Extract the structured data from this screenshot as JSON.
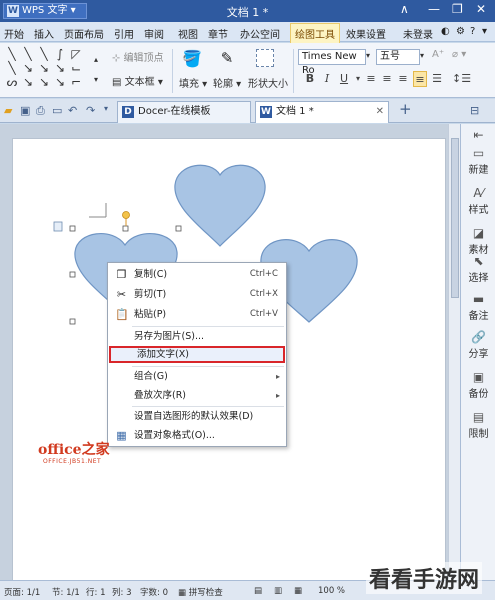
{
  "colors": {
    "accent": "#2f5aa0",
    "shape_fill": "#a8c4e4",
    "shape_stroke": "#6f95c4",
    "highlight": "#d9262a"
  },
  "titlebar": {
    "app_name": "WPS 文字",
    "doc_title": "文档 1 *"
  },
  "menu": {
    "items": [
      "开始",
      "插入",
      "页面布局",
      "引用",
      "审阅",
      "视图",
      "章节",
      "办公空间",
      "绘图工具",
      "效果设置"
    ],
    "active": "绘图工具",
    "login": "未登录"
  },
  "ribbon": {
    "edit_points": "编辑顶点",
    "text_box": "文本框",
    "fill": "填充",
    "outline": "轮廓",
    "shape_size": "形状大小",
    "font_name": "Times New Ro",
    "font_size": "五号",
    "bold": "B",
    "italic": "I",
    "underline": "U"
  },
  "tabs": [
    {
      "label": "Docer-在线模板",
      "badge": "D"
    },
    {
      "label": "文档 1 *",
      "badge": "W"
    }
  ],
  "side_panel": {
    "items": [
      "新建",
      "样式",
      "素材",
      "选择",
      "备注",
      "分享",
      "备份",
      "限制"
    ]
  },
  "context_menu": {
    "items": [
      {
        "label": "复制(C)",
        "shortcut": "Ctrl+C",
        "icon": "copy-icon"
      },
      {
        "label": "剪切(T)",
        "shortcut": "Ctrl+X",
        "icon": "cut-icon"
      },
      {
        "label": "粘贴(P)",
        "shortcut": "Ctrl+V",
        "icon": "paste-icon"
      },
      {
        "label": "另存为图片(S)...",
        "shortcut": ""
      },
      {
        "label": "添加文字(X)",
        "shortcut": "",
        "highlighted": true
      },
      {
        "label": "组合(G)",
        "submenu": true
      },
      {
        "label": "叠放次序(R)",
        "submenu": true
      },
      {
        "label": "设置自选图形的默认效果(D)",
        "shortcut": ""
      },
      {
        "label": "设置对象格式(O)...",
        "shortcut": "",
        "icon": "format-icon"
      }
    ]
  },
  "watermark": {
    "line1": "office之家",
    "line2": "OFFICE.JB51.NET"
  },
  "status": {
    "page": "页面: 1/1",
    "section": "节: 1/1",
    "row": "行: 1",
    "col": "列: 3",
    "words": "字数: 0",
    "spell": "拼写检查",
    "zoom": "100 %"
  },
  "corner_watermark": "看看手游网"
}
